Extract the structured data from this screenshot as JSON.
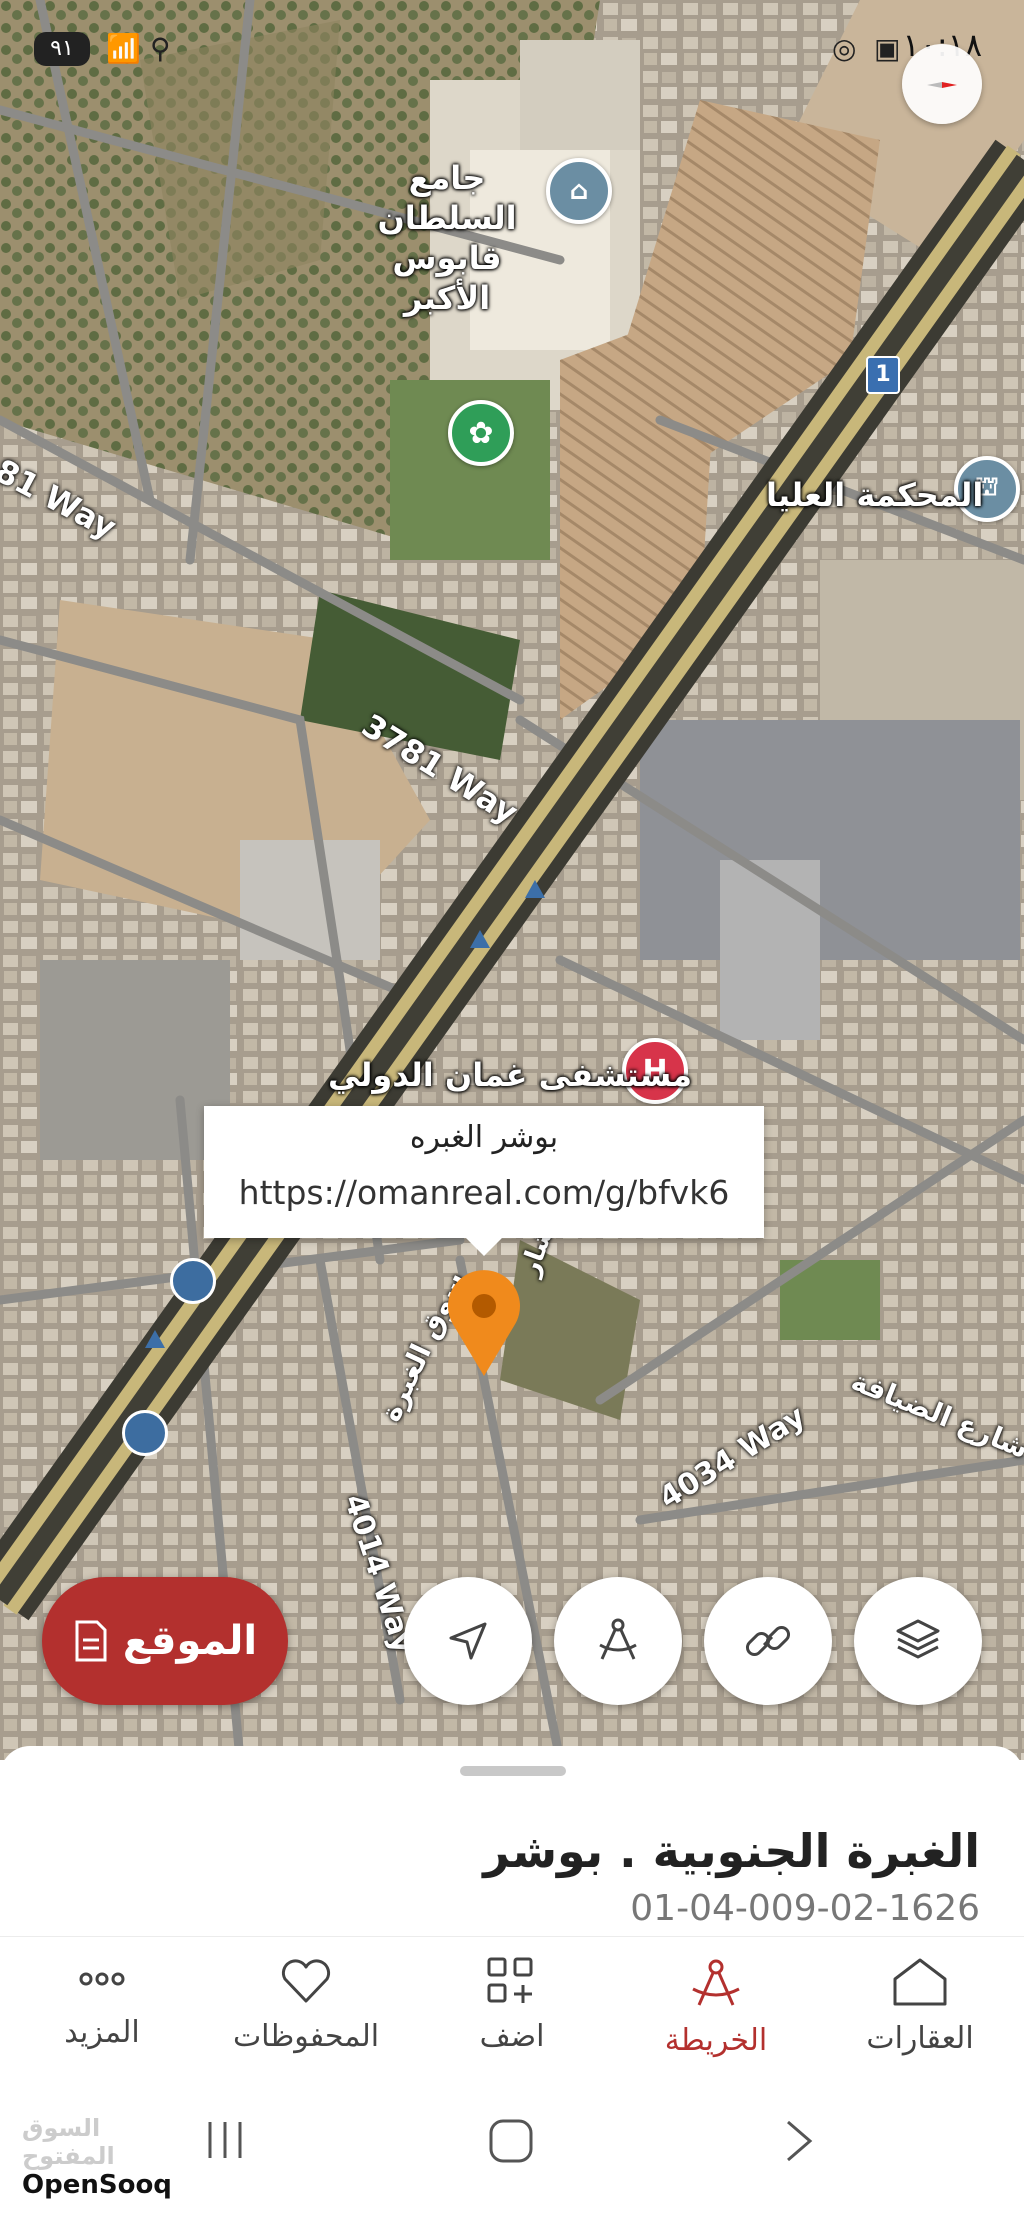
{
  "status_bar": {
    "battery": "٩١",
    "time": "١٠:١٨"
  },
  "map": {
    "labels": {
      "mosque": "جامع السلطان قابوس الأكبر",
      "court": "المحكمة العليا",
      "hospital": "مستشفى غمان الدولي",
      "hospital_marker": "H",
      "road_way_left": "81 Way",
      "road_3781": "3781 Way",
      "road_4014": "4014 Way",
      "road_4034": "4034 Way",
      "road_hospitality": "شارع الضيافة",
      "road_souq": "سوق الغبرة",
      "road_shar": "شار",
      "highway_shield": "1"
    },
    "popup": {
      "title": "بوشر الغبره",
      "url": "https://omanreal.com/g/bfvk6"
    },
    "location_button_label": "الموقع",
    "accent_color": "#b3302e"
  },
  "sheet": {
    "title": "الغبرة الجنوبية . بوشر",
    "code": "01-04-009-02-1626"
  },
  "bottom_nav": {
    "items": [
      {
        "label": "المزيد",
        "icon": "more-dots-icon"
      },
      {
        "label": "المحفوظات",
        "icon": "heart-icon"
      },
      {
        "label": "اضف",
        "icon": "add-grid-icon"
      },
      {
        "label": "الخريطة",
        "icon": "map-compass-icon"
      },
      {
        "label": "العقارات",
        "icon": "home-icon"
      }
    ],
    "active": "الخريطة"
  },
  "watermark": {
    "arabic": "السوق المفتوح",
    "english": "OpenSooq"
  }
}
